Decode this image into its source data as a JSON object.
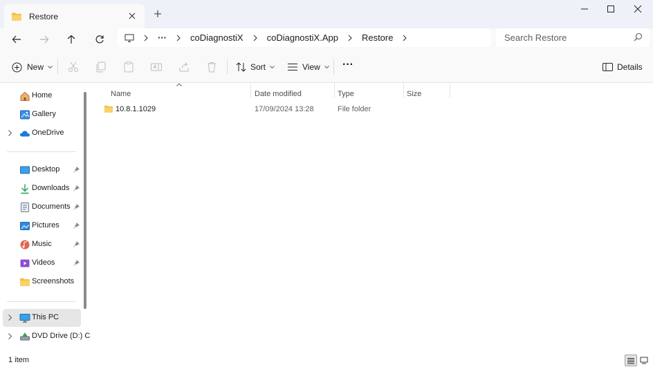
{
  "window": {
    "tab_title": "Restore",
    "colors": {
      "titlebar": "#eef1f8",
      "accent": "#0067c0",
      "folder": "#f4c045"
    }
  },
  "nav": {
    "breadcrumbs": [
      "coDiagnostiX",
      "coDiagnostiX.App",
      "Restore"
    ],
    "overflow": "···",
    "search_placeholder": "Search Restore"
  },
  "toolbar": {
    "new_label": "New",
    "sort_label": "Sort",
    "view_label": "View",
    "more_label": "···",
    "details_label": "Details"
  },
  "sidebar": {
    "top_items": [
      {
        "label": "Home",
        "icon": "home-icon"
      },
      {
        "label": "Gallery",
        "icon": "gallery-icon"
      },
      {
        "label": "OneDrive",
        "icon": "cloud-icon"
      }
    ],
    "quick_access": [
      {
        "label": "Desktop",
        "icon": "desktop-icon",
        "pinned": true
      },
      {
        "label": "Downloads",
        "icon": "download-icon",
        "pinned": true
      },
      {
        "label": "Documents",
        "icon": "document-icon",
        "pinned": true
      },
      {
        "label": "Pictures",
        "icon": "picture-icon",
        "pinned": true
      },
      {
        "label": "Music",
        "icon": "music-icon",
        "pinned": true
      },
      {
        "label": "Videos",
        "icon": "video-icon",
        "pinned": true
      },
      {
        "label": "Screenshots",
        "icon": "folder-icon",
        "pinned": false
      }
    ],
    "devices": [
      {
        "label": "This PC",
        "icon": "monitor-icon",
        "selected": true
      },
      {
        "label": "DVD Drive (D:) C",
        "icon": "dvd-icon"
      }
    ]
  },
  "list": {
    "columns": [
      "Name",
      "Date modified",
      "Type",
      "Size"
    ],
    "rows": [
      {
        "name": "10.8.1.1029",
        "date": "17/09/2024 13:28",
        "type": "File folder",
        "size": ""
      }
    ]
  },
  "status": {
    "count": "1 item"
  }
}
